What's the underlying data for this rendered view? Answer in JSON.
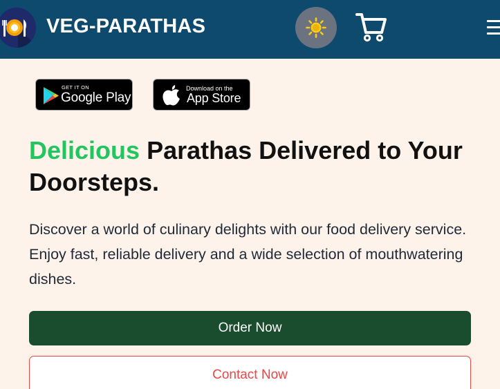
{
  "header": {
    "brand": "VEG-PARATHAS",
    "logo_icon": "plate-fork-knife-icon",
    "theme_icon": "sun-icon",
    "cart_icon": "cart-icon",
    "menu_icon": "hamburger-menu-icon"
  },
  "badges": {
    "google_play": {
      "small": "GET IT ON",
      "big": "Google Play"
    },
    "app_store": {
      "small": "Download on the",
      "big": "App Store"
    }
  },
  "hero": {
    "headline_accent": "Delicious",
    "headline_rest": " Parathas Delivered to Your Doorsteps.",
    "description": "Discover a world of culinary delights with our food delivery service. Enjoy fast, reliable delivery and a wide selection of mouthwatering dishes.",
    "order_button": "Order Now",
    "contact_button": "Contact Now"
  },
  "colors": {
    "navbar": "#0e4a6e",
    "page_background": "#fdf3ea",
    "accent_green": "#22c55e",
    "order_button": "#1a4d2e",
    "contact_border": "#ef4444",
    "sun": "#facc15"
  }
}
